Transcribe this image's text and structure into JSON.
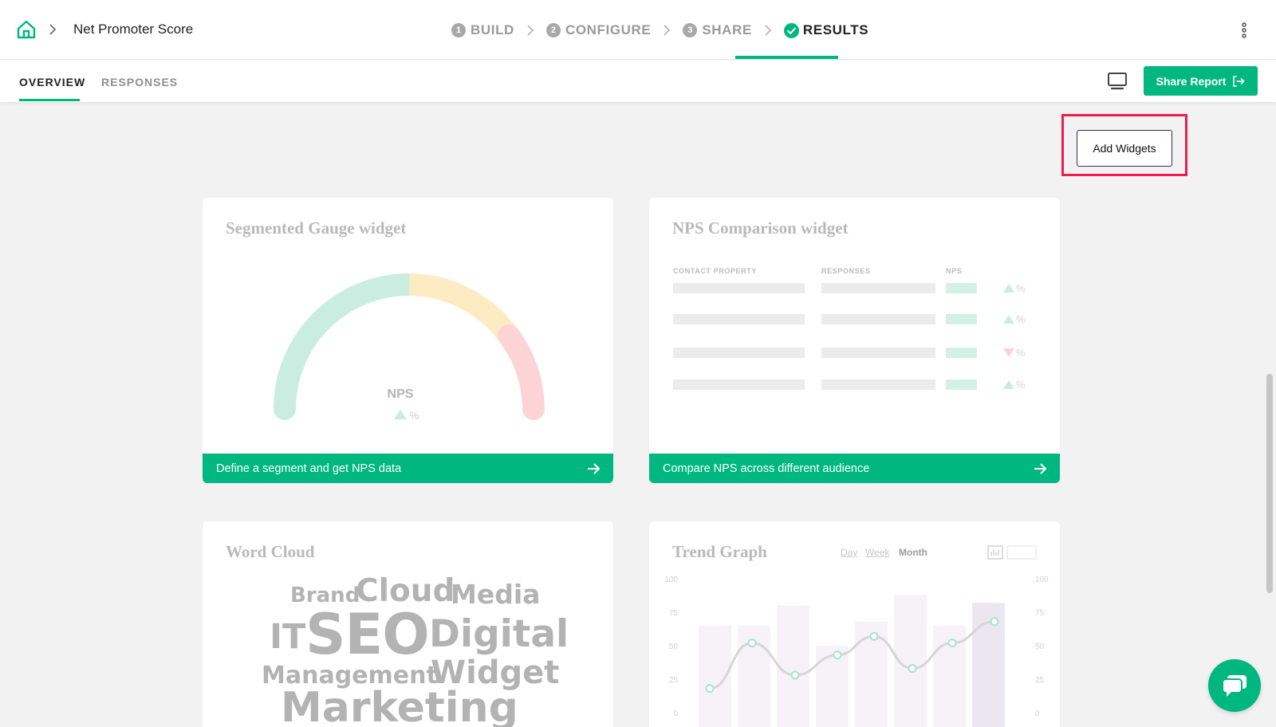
{
  "header": {
    "title": "Net Promoter Score",
    "steps": [
      {
        "num": "1",
        "label": "BUILD"
      },
      {
        "num": "2",
        "label": "CONFIGURE"
      },
      {
        "num": "3",
        "label": "SHARE"
      },
      {
        "num": "",
        "label": "RESULTS"
      }
    ]
  },
  "tabs": {
    "overview": "OVERVIEW",
    "responses": "RESPONSES"
  },
  "toolbar": {
    "share_label": "Share Report",
    "add_widgets_label": "Add Widgets"
  },
  "widgets": {
    "gauge": {
      "title": "Segmented Gauge widget",
      "nps_label": "NPS",
      "pct_symbol": "%",
      "cta": "Define a segment and get NPS data"
    },
    "comparison": {
      "title": "NPS Comparison widget",
      "headers": [
        "CONTACT PROPERTY",
        "RESPONSES",
        "NPS"
      ],
      "rows": [
        "up",
        "up",
        "down",
        "up"
      ],
      "pct_symbol": "%",
      "cta": "Compare NPS across different audience"
    },
    "wordcloud": {
      "title": "Word Cloud",
      "words": [
        "Brand",
        "Cloud",
        "Media",
        "IT",
        "SEO",
        "Digital",
        "Management",
        "Widget",
        "Marketing"
      ]
    },
    "trend": {
      "title": "Trend Graph",
      "ranges": [
        "Day",
        "Week",
        "Month"
      ],
      "selected_range": "Month",
      "yticks": [
        "100",
        "75",
        "50",
        "25",
        "0"
      ]
    }
  },
  "colors": {
    "accent": "#00b77f",
    "highlight": "#ee1c4f",
    "gauge_green": "#c9ede0",
    "gauge_yellow": "#fdebc4",
    "gauge_red": "#fcd4d6"
  },
  "icons": {
    "home": "home-icon",
    "more": "kebab-icon",
    "device": "monitor-icon",
    "chat": "chat-icon"
  }
}
